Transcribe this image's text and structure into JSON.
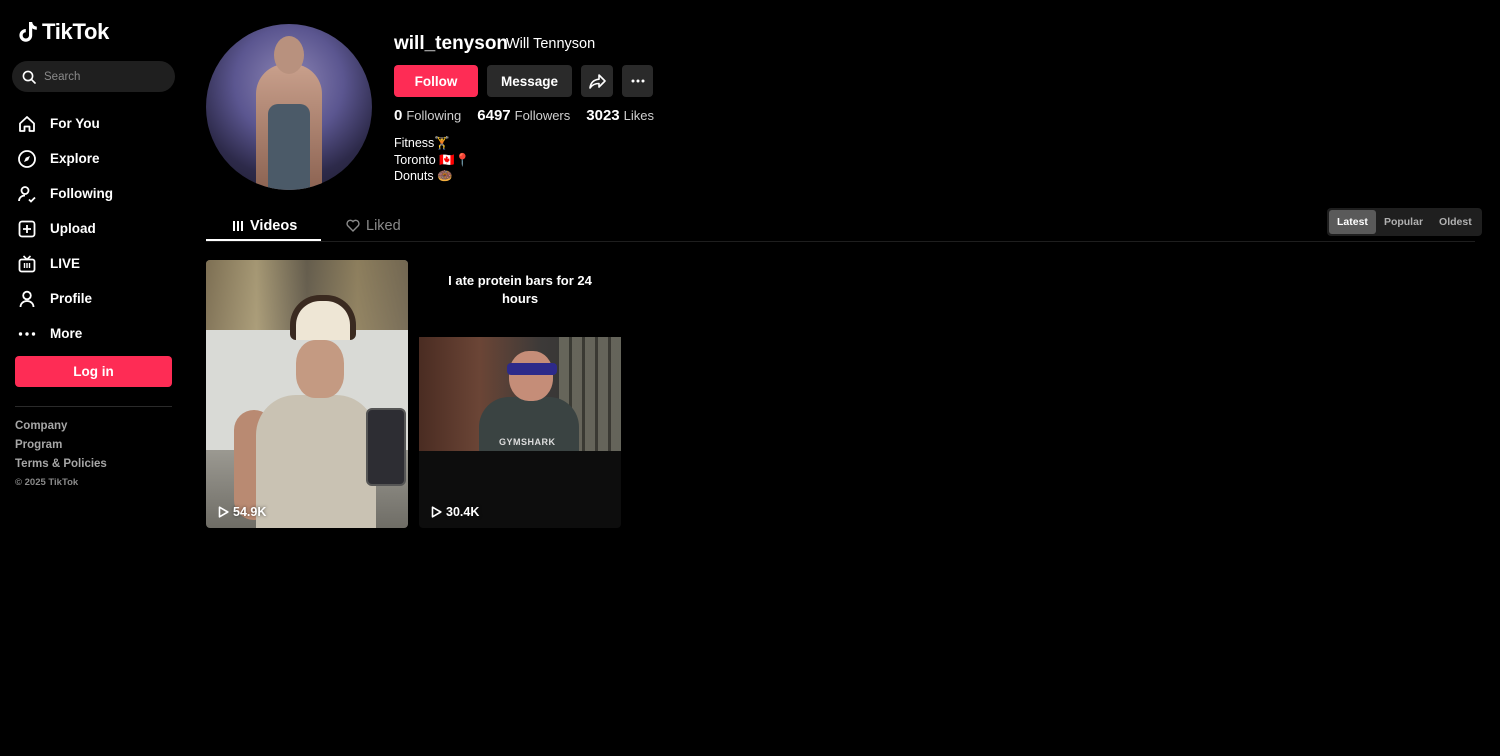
{
  "app": {
    "name": "TikTok"
  },
  "search": {
    "placeholder": "Search"
  },
  "sidebar": {
    "items": [
      {
        "label": "For You",
        "icon": "home-icon"
      },
      {
        "label": "Explore",
        "icon": "compass-icon"
      },
      {
        "label": "Following",
        "icon": "following-icon"
      },
      {
        "label": "Upload",
        "icon": "upload-icon"
      },
      {
        "label": "LIVE",
        "icon": "live-icon"
      },
      {
        "label": "Profile",
        "icon": "person-icon"
      },
      {
        "label": "More",
        "icon": "more-icon"
      }
    ],
    "login_label": "Log in",
    "footer": [
      "Company",
      "Program",
      "Terms & Policies"
    ],
    "copyright": "© 2025 TikTok"
  },
  "profile": {
    "username": "will_tenyson",
    "display_name": "Will Tennyson",
    "follow_label": "Follow",
    "message_label": "Message",
    "stats": {
      "following_count": "0",
      "following_label": "Following",
      "followers_count": "6497",
      "followers_label": "Followers",
      "likes_count": "3023",
      "likes_label": "Likes"
    },
    "bio": [
      "Fitness🏋",
      "Toronto 🇨🇦📍",
      "Donuts 🍩"
    ]
  },
  "tabs": {
    "videos": "Videos",
    "liked": "Liked"
  },
  "sort": {
    "options": [
      "Latest",
      "Popular",
      "Oldest"
    ],
    "selected": "Latest"
  },
  "videos": [
    {
      "views": "54.9K",
      "caption": ""
    },
    {
      "views": "30.4K",
      "caption": "I ate protein bars for 24 hours",
      "thumb_text": "GYMSHARK"
    }
  ],
  "colors": {
    "accent": "#fe2c55",
    "background": "#000000",
    "surface": "#2a2a2a"
  }
}
